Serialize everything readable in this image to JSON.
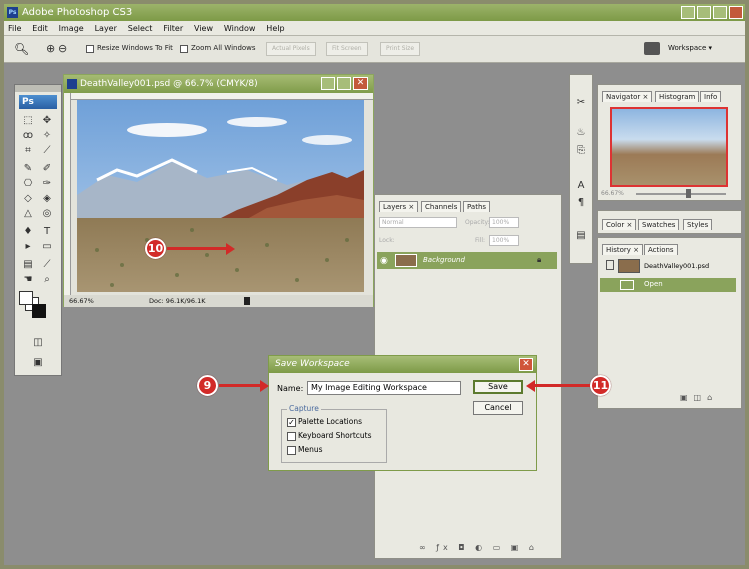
{
  "window": {
    "title": "Adobe Photoshop CS3",
    "app_badge": "Ps"
  },
  "menu": [
    "File",
    "Edit",
    "Image",
    "Layer",
    "Select",
    "Filter",
    "View",
    "Window",
    "Help"
  ],
  "options_bar": {
    "resize_windows": "Resize Windows To Fit",
    "zoom_all": "Zoom All Windows",
    "actual_pixels": "Actual Pixels",
    "fit_screen": "Fit Screen",
    "print_size": "Print Size",
    "workspace": "Workspace ▾"
  },
  "toolbox": {
    "logo": "Ps"
  },
  "image_window": {
    "title": "DeathValley001.psd @ 66.7% (CMYK/8)",
    "zoom": "66.67%",
    "doc_info": "Doc: 96.1K/96.1K"
  },
  "layers_panel": {
    "tabs": [
      "Layers ×",
      "Channels",
      "Paths"
    ],
    "blend_mode": "Normal",
    "opacity_label": "Opacity:",
    "opacity_value": "100%",
    "lock_label": "Lock:",
    "fill_label": "Fill:",
    "fill_value": "100%",
    "layer_name": "Background"
  },
  "navigator_panel": {
    "tabs": [
      "Navigator ×",
      "Histogram",
      "Info"
    ],
    "zoom": "66.67%"
  },
  "color_panel": {
    "tabs": [
      "Color ×",
      "Swatches",
      "Styles"
    ]
  },
  "history_panel": {
    "tabs": [
      "History ×",
      "Actions"
    ],
    "items": [
      "DeathValley001.psd",
      "Open"
    ]
  },
  "dialog": {
    "title": "Save Workspace",
    "name_label": "Name:",
    "name_value": "My Image Editing Workspace",
    "save": "Save",
    "cancel": "Cancel",
    "capture_label": "Capture",
    "options": [
      {
        "label": "Palette Locations",
        "checked": true
      },
      {
        "label": "Keyboard Shortcuts",
        "checked": false
      },
      {
        "label": "Menus",
        "checked": false
      }
    ]
  },
  "callouts": [
    "9",
    "10",
    "11"
  ],
  "colors": {
    "accent": "#7d9a47",
    "callout": "#d22a28",
    "workspace": "#8e8e8e"
  }
}
